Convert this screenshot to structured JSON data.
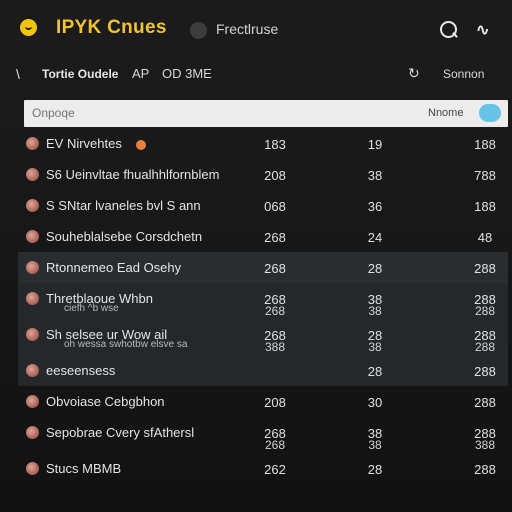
{
  "header": {
    "app_title": "IPYK Cnues",
    "link": "Frectlruse"
  },
  "subbar": {
    "back": "\\",
    "title": "Tortie Oudele",
    "tab1": "AP",
    "tab2": "OD 3ME",
    "refresh": "↻",
    "right": "Sonnon"
  },
  "filter": {
    "placeholder": "Onpoqe",
    "label": "Nnome"
  },
  "rows": [
    {
      "name": "EV Nirvehtes",
      "sub": "",
      "c1": "183",
      "c1b": "",
      "c2": "19",
      "c2b": "",
      "c3": "188",
      "c3b": ""
    },
    {
      "name": "S6  Ueinvltae fhualhhlfornblem",
      "sub": "",
      "c1": "208",
      "c1b": "",
      "c2": "38",
      "c2b": "",
      "c3": "788",
      "c3b": ""
    },
    {
      "name": "S SNtar lvaneles bvl S ann",
      "sub": "",
      "c1": "068",
      "c1b": "",
      "c2": "36",
      "c2b": "",
      "c3": "188",
      "c3b": ""
    },
    {
      "name": "Souheblalsebe Corsdchetn",
      "sub": "",
      "c1": "268",
      "c1b": "",
      "c2": "24",
      "c2b": "",
      "c3": "48",
      "c3b": ""
    },
    {
      "name": "Rtonnemeo Ead Osehy",
      "sub": "",
      "c1": "268",
      "c1b": "",
      "c2": "28",
      "c2b": "",
      "c3": "288",
      "c3b": ""
    },
    {
      "name": "Thretblaoue Whbn",
      "sub": "ciefh ^b wse",
      "c1": "268",
      "c1b": "268",
      "c2": "38",
      "c2b": "38",
      "c3": "288",
      "c3b": "288"
    },
    {
      "name": "Sh selsee ur Wow ail",
      "sub": "oh wessa  swhotbw elsve sa",
      "c1": "268",
      "c1b": "388",
      "c2": "28",
      "c2b": "38",
      "c3": "288",
      "c3b": "288"
    },
    {
      "name": "eeseensess",
      "sub": "",
      "c1": "",
      "c1b": "",
      "c2": "28",
      "c2b": "",
      "c3": "288",
      "c3b": ""
    },
    {
      "name": "Obvoiase Cebgbhon",
      "sub": "",
      "c1": "208",
      "c1b": "",
      "c2": "30",
      "c2b": "",
      "c3": "288",
      "c3b": ""
    },
    {
      "name": "Sepobrae Cvery sfAthersl",
      "sub": "",
      "c1": "268",
      "c1b": "268",
      "c2": "38",
      "c2b": "38",
      "c3": "288",
      "c3b": "388"
    },
    {
      "name": "Stucs MBMB",
      "sub": "",
      "c1": "262",
      "c1b": "",
      "c2": "28",
      "c2b": "",
      "c3": "288",
      "c3b": ""
    }
  ]
}
